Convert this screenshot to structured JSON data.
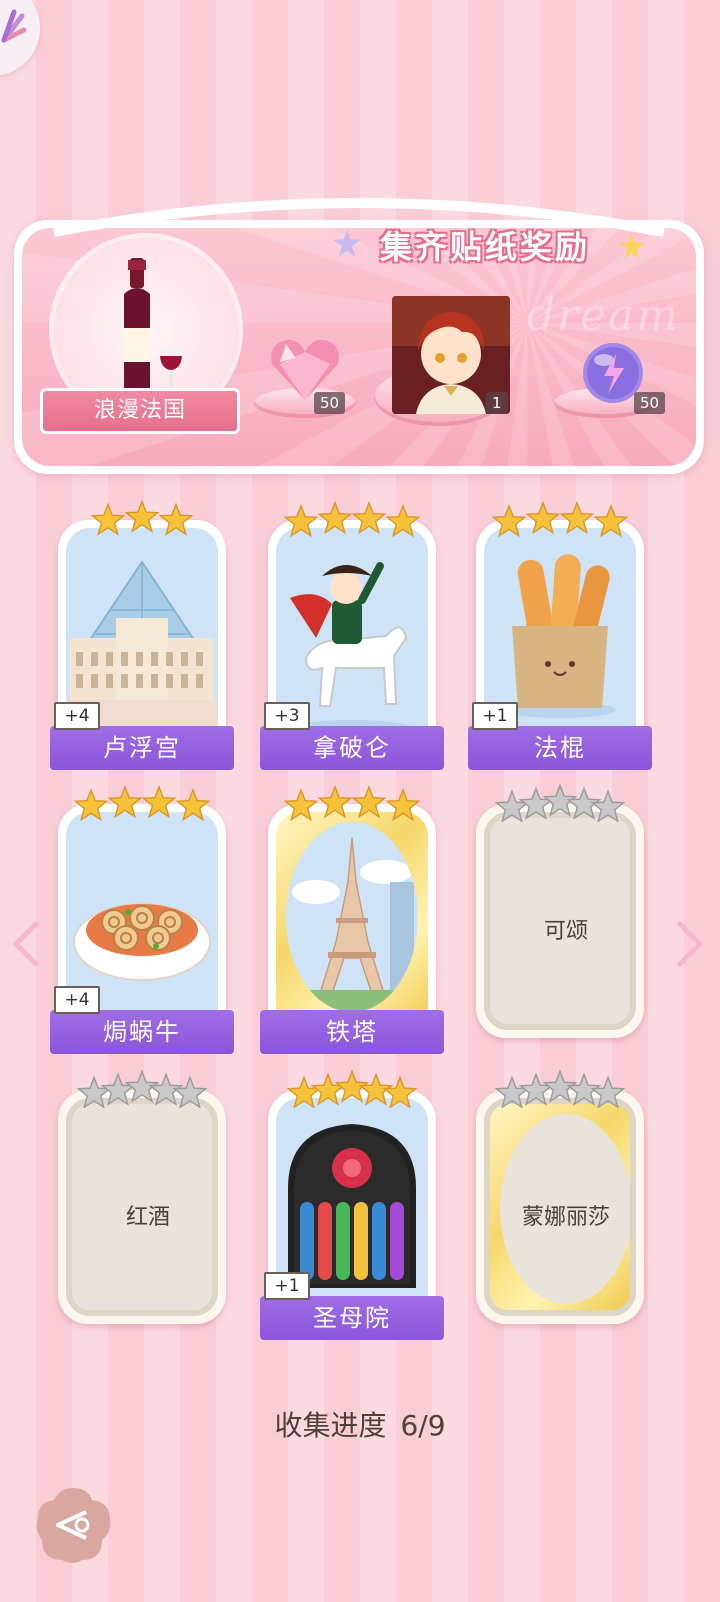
{
  "banner": {
    "title": "集齐贴纸奖励",
    "watermark": "dream",
    "theme_name": "浪漫法国",
    "rewards": [
      {
        "icon": "pink-diamond-icon",
        "count": "50"
      },
      {
        "icon": "character-portrait",
        "count": "1"
      },
      {
        "icon": "energy-orb-icon",
        "count": "50"
      }
    ]
  },
  "cards": [
    {
      "name": "卢浮宫",
      "stars": 3,
      "max_stars": 3,
      "plus": "+4",
      "collected": true,
      "art": "louvre"
    },
    {
      "name": "拿破仑",
      "stars": 4,
      "max_stars": 4,
      "plus": "+3",
      "collected": true,
      "art": "napoleon"
    },
    {
      "name": "法棍",
      "stars": 4,
      "max_stars": 4,
      "plus": "+1",
      "collected": true,
      "art": "baguette"
    },
    {
      "name": "焗蜗牛",
      "stars": 4,
      "max_stars": 4,
      "plus": "+4",
      "collected": true,
      "art": "escargot"
    },
    {
      "name": "铁塔",
      "stars": 4,
      "max_stars": 4,
      "plus": "",
      "collected": true,
      "art": "eiffel",
      "gold": true
    },
    {
      "name": "可颂",
      "stars": 0,
      "max_stars": 5,
      "plus": "",
      "collected": false
    },
    {
      "name": "红酒",
      "stars": 0,
      "max_stars": 5,
      "plus": "",
      "collected": false
    },
    {
      "name": "圣母院",
      "stars": 5,
      "max_stars": 5,
      "plus": "+1",
      "collected": true,
      "art": "notredame"
    },
    {
      "name": "蒙娜丽莎",
      "stars": 0,
      "max_stars": 5,
      "plus": "",
      "collected": false,
      "gold": true
    }
  ],
  "progress": {
    "label": "收集进度",
    "value": "6/9"
  },
  "colors": {
    "accent_purple": "#8a55d9",
    "banner_pink": "#f7aabd",
    "star_gold": "#f5c23a",
    "star_grey": "#c9c9c9"
  }
}
